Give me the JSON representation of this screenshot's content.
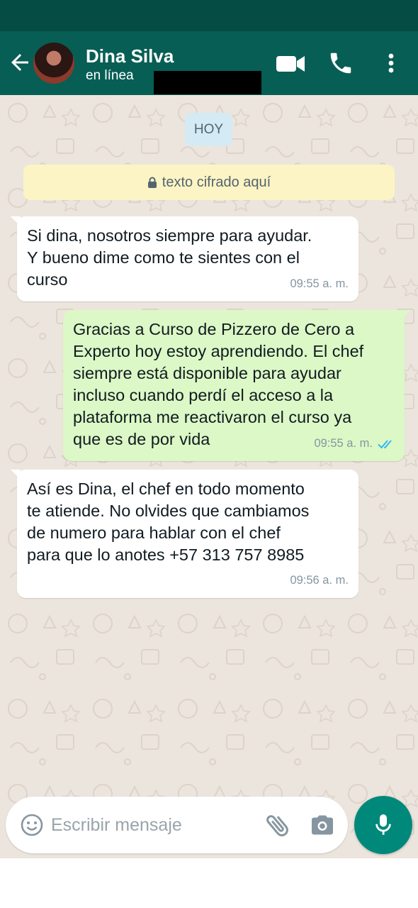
{
  "header": {
    "contact_name": "Dina Silva",
    "contact_status": "en línea",
    "icons": [
      "back-arrow-icon",
      "video-call-icon",
      "phone-icon",
      "more-vert-icon"
    ]
  },
  "chat": {
    "date_label": "HOY",
    "encryption_notice": "texto cifrado aquí",
    "messages": [
      {
        "direction": "incoming",
        "text": "Si dina, nosotros siempre para ayudar.\nY bueno dime como te sientes con el\ncurso",
        "time": "09:55 a. m."
      },
      {
        "direction": "outgoing",
        "text": "Gracias a Curso de Pizzero de Cero a\nExperto hoy estoy aprendiendo. El chef\nsiempre está disponible para ayudar\nincluso cuando perdí el acceso a la\nplataforma me reactivaron el curso ya\nque es de por vida",
        "time": "09:55 a. m.",
        "status": "read",
        "status_icon": "double-check-icon"
      },
      {
        "direction": "incoming",
        "text": "Así es Dina, el chef en todo momento\nte atiende. No olvides que cambiamos\nde numero para hablar con el chef\npara que lo anotes +57 313 757 8985",
        "time": "09:56 a. m."
      }
    ]
  },
  "composer": {
    "placeholder": "Escribir mensaje",
    "value": "",
    "icons": [
      "emoji-icon",
      "paperclip-icon",
      "camera-icon",
      "mic-icon"
    ]
  },
  "colors": {
    "header": "#075e54",
    "status_bar": "#044c44",
    "chat_background": "#ece5dd",
    "outgoing_bubble": "#dcf8c6",
    "incoming_bubble": "#ffffff",
    "read_ticks": "#34b7f1",
    "mic_button": "#00897b"
  }
}
